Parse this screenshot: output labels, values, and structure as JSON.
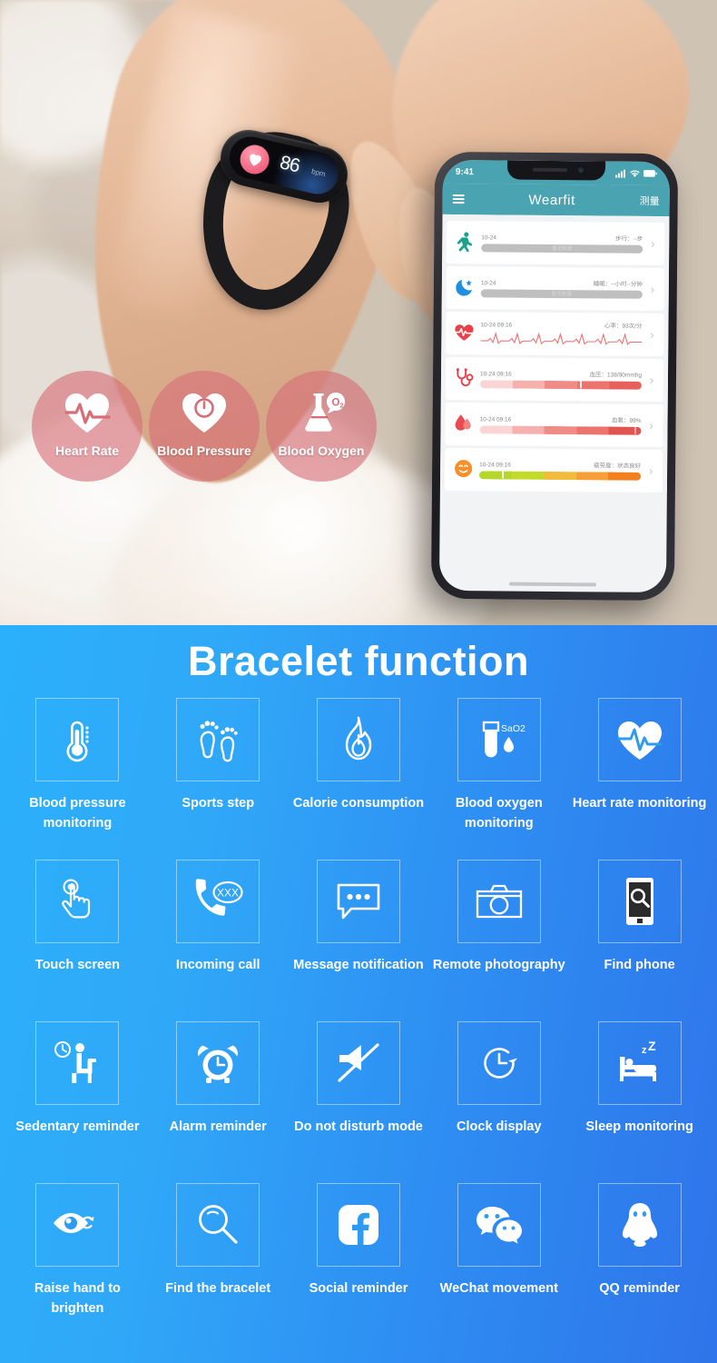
{
  "hero": {
    "watch": {
      "bpm_value": "86",
      "bpm_unit": "bpm",
      "heart_icon": "heart-icon"
    },
    "bubbles": [
      {
        "label": "Heart Rate",
        "icon": "heart-pulse-icon"
      },
      {
        "label": "Blood Pressure",
        "icon": "heart-gauge-icon"
      },
      {
        "label": "Blood Oxygen",
        "icon": "flask-o2-icon"
      }
    ],
    "bubble_color": "#d66e78"
  },
  "phone": {
    "status": {
      "time": "9:41",
      "signal_icon": "signal-bars-icon",
      "wifi_icon": "wifi-icon",
      "battery_icon": "battery-icon"
    },
    "appbar": {
      "menu_icon": "hamburger-menu-icon",
      "title": "Wearfit",
      "action_label": "测量"
    },
    "accent_color": "#4aa3b0",
    "cards": [
      {
        "icon": "walking-person-icon",
        "date": "10-24",
        "value": "步行：--步",
        "bar_type": "nodata",
        "bar_text": "暂无数据"
      },
      {
        "icon": "moon-star-icon",
        "date": "10-24",
        "value": "睡眠：--小时--分钟",
        "bar_type": "nodata",
        "bar_text": "暂无数据"
      },
      {
        "icon": "heartbeat-icon",
        "date": "10-24 09:16",
        "value": "心率：93次/分",
        "bar_type": "ecg",
        "bar_text": ""
      },
      {
        "icon": "stethoscope-icon",
        "date": "10-24 09:16",
        "value": "血压：138/90mmhg",
        "bar_type": "gradient-red",
        "bar_text": ""
      },
      {
        "icon": "blood-drop-icon",
        "date": "10-24 09:16",
        "value": "血氧：99%",
        "bar_type": "gradient-red",
        "bar_text": ""
      },
      {
        "icon": "smiley-face-icon",
        "date": "10-24 09:16",
        "value": "疲劳度：状态良好",
        "bar_type": "gradient-green-orange",
        "bar_text": ""
      }
    ]
  },
  "features": {
    "title": "Bracelet function",
    "items": [
      {
        "label": "Blood pressure monitoring",
        "icon": "thermometer-icon"
      },
      {
        "label": "Sports step",
        "icon": "footprints-icon"
      },
      {
        "label": "Calorie consumption",
        "icon": "flame-icon"
      },
      {
        "label": "Blood oxygen monitoring",
        "icon": "test-tube-sao2-icon",
        "icon_text": "SaO2"
      },
      {
        "label": "Heart rate monitoring",
        "icon": "heart-pulse-solid-icon"
      },
      {
        "label": "Touch screen",
        "icon": "tap-finger-icon"
      },
      {
        "label": "Incoming call",
        "icon": "phone-call-xxx-icon",
        "icon_text": "XXX"
      },
      {
        "label": "Message notification",
        "icon": "chat-bubble-dots-icon"
      },
      {
        "label": "Remote photography",
        "icon": "camera-icon"
      },
      {
        "label": "Find phone",
        "icon": "phone-search-icon"
      },
      {
        "label": "Sedentary reminder",
        "icon": "sitting-person-clock-icon"
      },
      {
        "label": "Alarm reminder",
        "icon": "alarm-clock-icon"
      },
      {
        "label": "Do not disturb mode",
        "icon": "mute-bell-slash-icon"
      },
      {
        "label": "Clock display",
        "icon": "clock-arrow-icon"
      },
      {
        "label": "Sleep monitoring",
        "icon": "bed-zzz-icon",
        "icon_text": "zZ"
      },
      {
        "label": "Raise hand to brighten",
        "icon": "eye-refresh-icon"
      },
      {
        "label": "Find the bracelet",
        "icon": "magnifier-icon"
      },
      {
        "label": "Social reminder",
        "icon": "facebook-icon"
      },
      {
        "label": "WeChat movement",
        "icon": "wechat-icon"
      },
      {
        "label": "QQ reminder",
        "icon": "qq-penguin-icon"
      }
    ]
  }
}
